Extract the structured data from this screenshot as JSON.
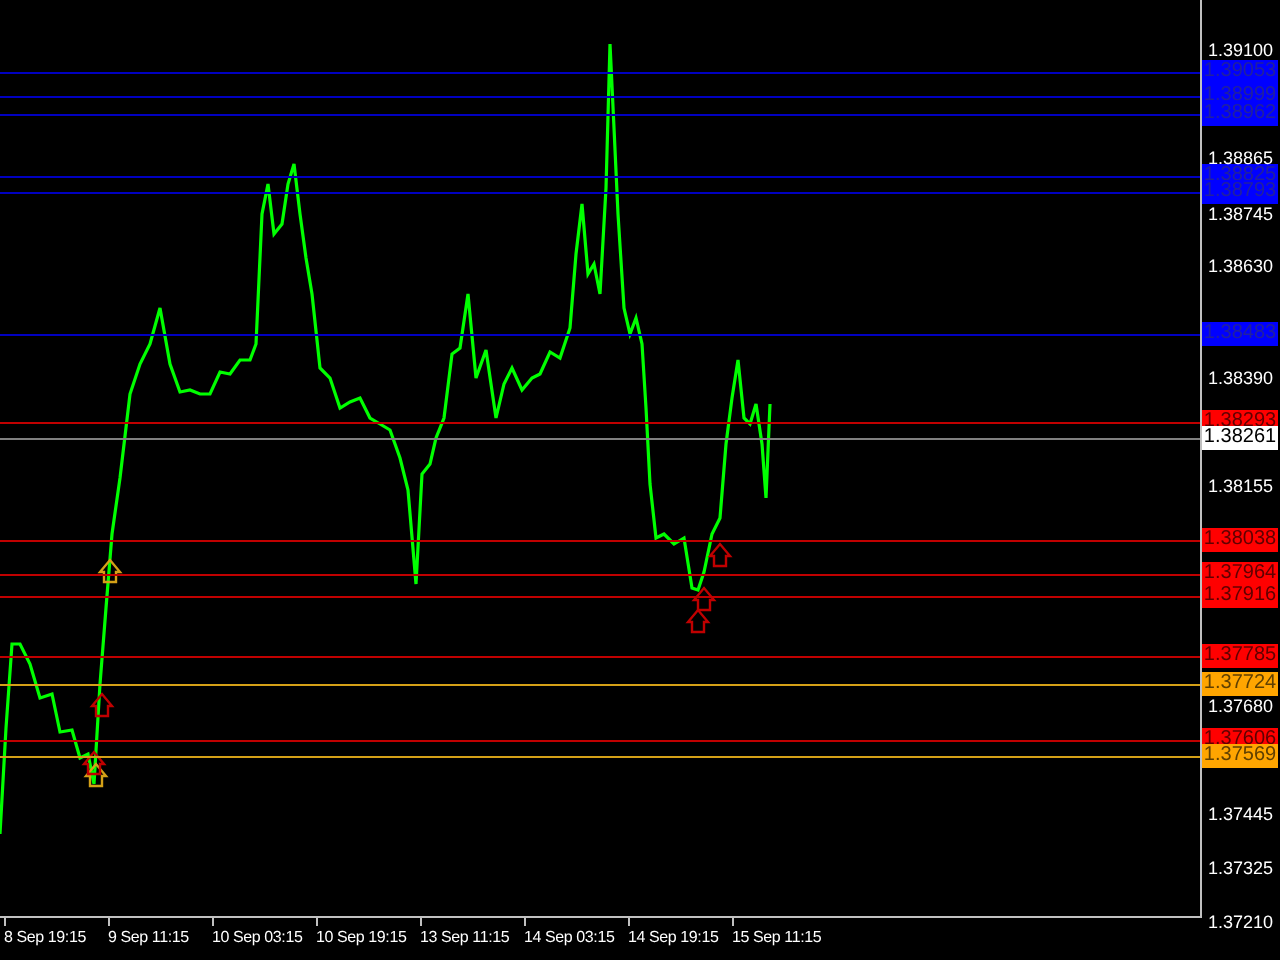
{
  "price_axis": {
    "ticks": [
      "1.39100",
      "1.38865",
      "1.38745",
      "1.38630",
      "1.38390",
      "1.38155",
      "1.37680",
      "1.37445",
      "1.37325",
      "1.37210"
    ]
  },
  "time_axis": {
    "labels": [
      "8 Sep 19:15",
      "9 Sep 11:15",
      "10 Sep 03:15",
      "10 Sep 19:15",
      "13 Sep 11:15",
      "14 Sep 03:15",
      "14 Sep 19:15",
      "15 Sep 11:15"
    ]
  },
  "levels": [
    {
      "label": "1.39053",
      "color": "#0000ff"
    },
    {
      "label": "1.38999",
      "color": "#0000ff"
    },
    {
      "label": "1.38962",
      "color": "#0000ff"
    },
    {
      "label": "1.38825",
      "color": "#0000ff"
    },
    {
      "label": "1.38793",
      "color": "#0000ff"
    },
    {
      "label": "1.38483",
      "color": "#0000ff"
    },
    {
      "label": "1.38293",
      "color": "#ff0000"
    },
    {
      "label": "1.38261",
      "color": "#ffffff"
    },
    {
      "label": "1.38038",
      "color": "#ff0000"
    },
    {
      "label": "1.37964",
      "color": "#ff0000"
    },
    {
      "label": "1.37916",
      "color": "#ff0000"
    },
    {
      "label": "1.37785",
      "color": "#ff0000"
    },
    {
      "label": "1.37724",
      "color": "#ffa500"
    },
    {
      "label": "1.37606",
      "color": "#ff0000"
    },
    {
      "label": "1.37569",
      "color": "#ffa500"
    }
  ]
}
